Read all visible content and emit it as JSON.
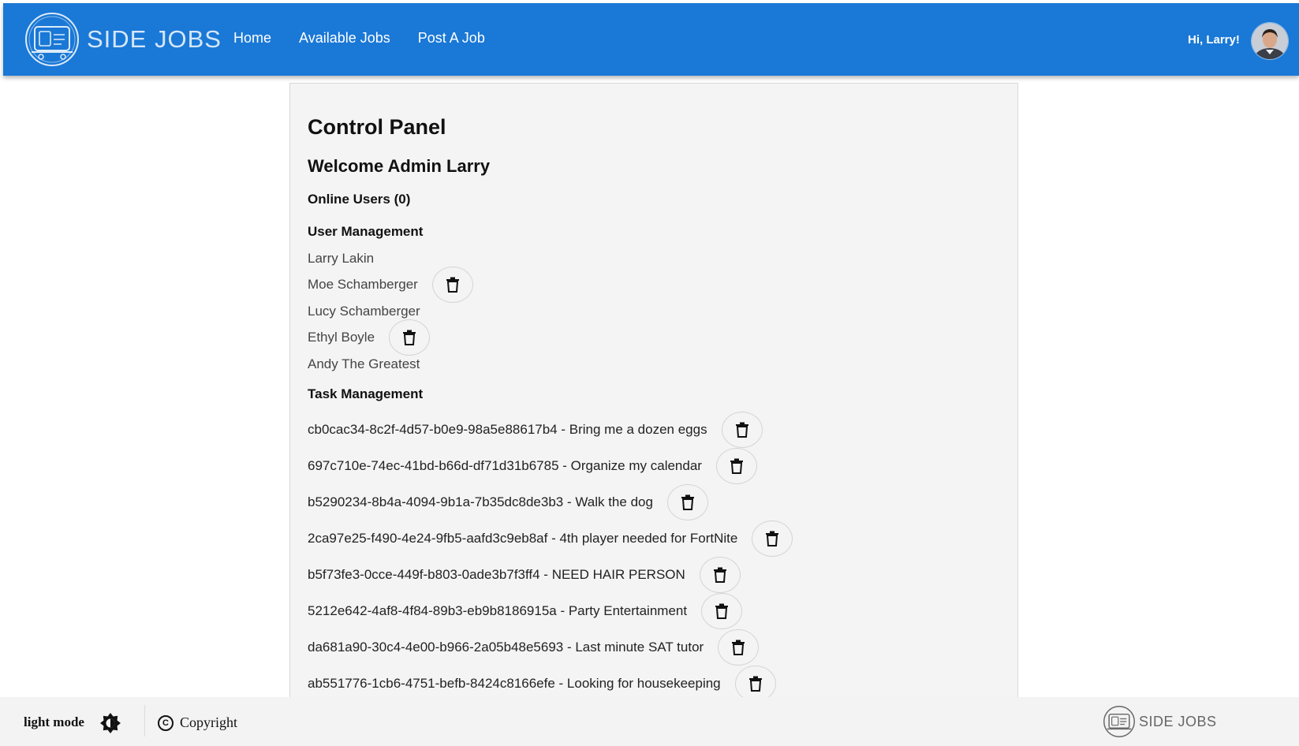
{
  "navbar": {
    "brand": "SIDE JOBS",
    "links": [
      "Home",
      "Available Jobs",
      "Post A Job"
    ],
    "greeting": "Hi, Larry!",
    "bg_color": "#1a78d6"
  },
  "panel": {
    "title": "Control Panel",
    "welcome": "Welcome Admin Larry",
    "online_users": "Online Users (0)",
    "user_section": "User Management",
    "users": [
      {
        "name": "Larry Lakin",
        "deletable": false
      },
      {
        "name": "Moe Schamberger",
        "deletable": true
      },
      {
        "name": "Lucy Schamberger",
        "deletable": false
      },
      {
        "name": "Ethyl Boyle",
        "deletable": true
      },
      {
        "name": "Andy The Greatest",
        "deletable": false
      }
    ],
    "task_section": "Task Management",
    "tasks": [
      {
        "text": "cb0cac34-8c2f-4d57-b0e9-98a5e88617b4 - Bring me a dozen eggs"
      },
      {
        "text": "697c710e-74ec-41bd-b66d-df71d31b6785 - Organize my calendar"
      },
      {
        "text": "b5290234-8b4a-4094-9b1a-7b35dc8de3b3 - Walk the dog"
      },
      {
        "text": "2ca97e25-f490-4e24-9fb5-aafd3c9eb8af - 4th player needed for FortNite"
      },
      {
        "text": "b5f73fe3-0cce-449f-b803-0ade3b7f3ff4 - NEED HAIR PERSON"
      },
      {
        "text": "5212e642-4af8-4f84-89b3-eb9b8186915a - Party Entertainment"
      },
      {
        "text": "da681a90-30c4-4e00-b966-2a05b48e5693 - Last minute SAT tutor"
      },
      {
        "text": "ab551776-1cb6-4751-befb-8424c8166efe - Looking for housekeeping"
      }
    ],
    "delete_icon": "trash-icon"
  },
  "footer": {
    "mode_label": "light mode",
    "mode_icon": "brightness-icon",
    "copyright_label": "Copyright",
    "brand": "SIDE JOBS"
  }
}
